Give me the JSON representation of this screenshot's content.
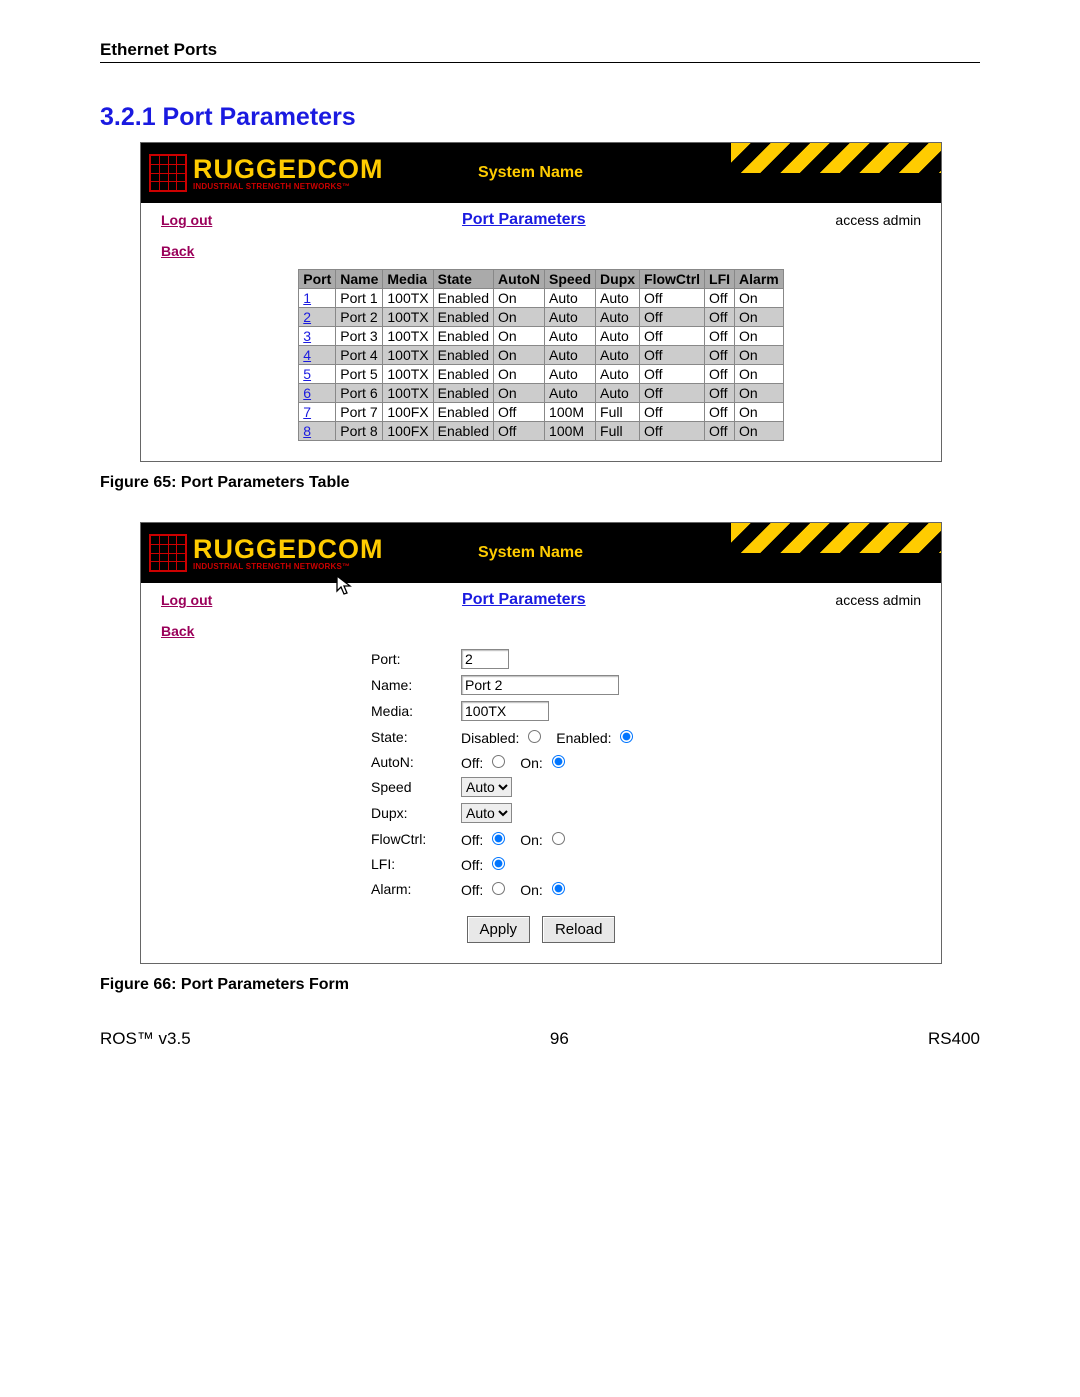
{
  "header": {
    "running": "Ethernet Ports"
  },
  "section": {
    "num_title": "3.2.1  Port Parameters"
  },
  "brand": {
    "name": "RUGGEDCOM",
    "tag": "INDUSTRIAL STRENGTH NETWORKS™",
    "sysname": "System Name"
  },
  "nav": {
    "logout": "Log out",
    "back": "Back",
    "page_title": "Port Parameters",
    "access": "access admin"
  },
  "table": {
    "headers": [
      "Port",
      "Name",
      "Media",
      "State",
      "AutoN",
      "Speed",
      "Dupx",
      "FlowCtrl",
      "LFI",
      "Alarm"
    ],
    "rows": [
      {
        "port": "1",
        "name": "Port 1",
        "media": "100TX",
        "state": "Enabled",
        "auton": "On",
        "speed": "Auto",
        "dupx": "Auto",
        "flow": "Off",
        "lfi": "Off",
        "alarm": "On"
      },
      {
        "port": "2",
        "name": "Port 2",
        "media": "100TX",
        "state": "Enabled",
        "auton": "On",
        "speed": "Auto",
        "dupx": "Auto",
        "flow": "Off",
        "lfi": "Off",
        "alarm": "On"
      },
      {
        "port": "3",
        "name": "Port 3",
        "media": "100TX",
        "state": "Enabled",
        "auton": "On",
        "speed": "Auto",
        "dupx": "Auto",
        "flow": "Off",
        "lfi": "Off",
        "alarm": "On"
      },
      {
        "port": "4",
        "name": "Port 4",
        "media": "100TX",
        "state": "Enabled",
        "auton": "On",
        "speed": "Auto",
        "dupx": "Auto",
        "flow": "Off",
        "lfi": "Off",
        "alarm": "On"
      },
      {
        "port": "5",
        "name": "Port 5",
        "media": "100TX",
        "state": "Enabled",
        "auton": "On",
        "speed": "Auto",
        "dupx": "Auto",
        "flow": "Off",
        "lfi": "Off",
        "alarm": "On"
      },
      {
        "port": "6",
        "name": "Port 6",
        "media": "100TX",
        "state": "Enabled",
        "auton": "On",
        "speed": "Auto",
        "dupx": "Auto",
        "flow": "Off",
        "lfi": "Off",
        "alarm": "On"
      },
      {
        "port": "7",
        "name": "Port 7",
        "media": "100FX",
        "state": "Enabled",
        "auton": "Off",
        "speed": "100M",
        "dupx": "Full",
        "flow": "Off",
        "lfi": "Off",
        "alarm": "On"
      },
      {
        "port": "8",
        "name": "Port 8",
        "media": "100FX",
        "state": "Enabled",
        "auton": "Off",
        "speed": "100M",
        "dupx": "Full",
        "flow": "Off",
        "lfi": "Off",
        "alarm": "On"
      }
    ]
  },
  "captions": {
    "fig65": "Figure 65: Port Parameters Table",
    "fig66": "Figure 66: Port Parameters Form"
  },
  "form": {
    "labels": {
      "port": "Port:",
      "name": "Name:",
      "media": "Media:",
      "state": "State:",
      "auton": "AutoN:",
      "speed": "Speed",
      "dupx": "Dupx:",
      "flow": "FlowCtrl:",
      "lfi": "LFI:",
      "alarm": "Alarm:",
      "disabled": "Disabled:",
      "enabled": "Enabled:",
      "off": "Off:",
      "on": "On:",
      "apply": "Apply",
      "reload": "Reload"
    },
    "values": {
      "port": "2",
      "name": "Port 2",
      "media": "100TX",
      "speed": "Auto",
      "dupx": "Auto"
    },
    "radios": {
      "state": "Enabled",
      "auton": "On",
      "flow": "Off",
      "lfi": "Off",
      "alarm": "On"
    }
  },
  "footer": {
    "left": "ROS™  v3.5",
    "center": "96",
    "right": "RS400"
  }
}
